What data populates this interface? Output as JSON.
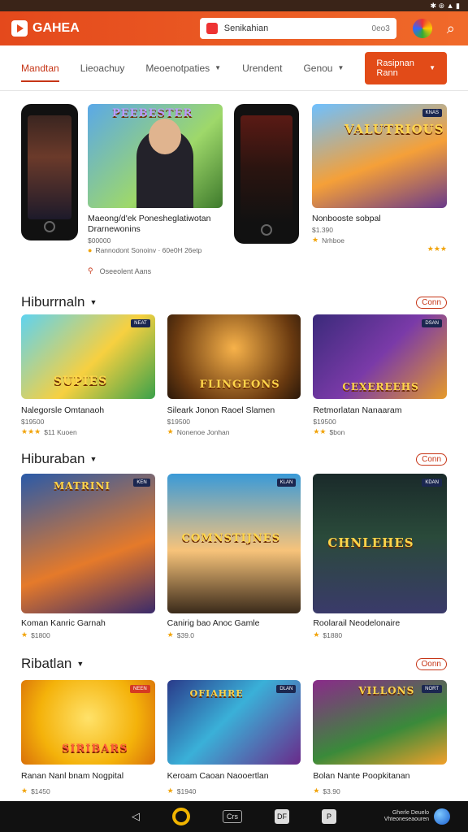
{
  "status": {
    "icons": "✱ ⊛ ▲ ▮"
  },
  "header": {
    "logo_text": "GAHEA",
    "search_value": "Senikahian",
    "search_code": "0eo3"
  },
  "tabs": [
    {
      "label": "Mandtan",
      "active": true
    },
    {
      "label": "Lieoachuy"
    },
    {
      "label": "Meoenotpaties",
      "dropdown": true
    },
    {
      "label": "Urendent"
    },
    {
      "label": "Genou",
      "dropdown": true
    }
  ],
  "cta_label": "Rasipnan Rann",
  "featured": [
    {
      "title": "",
      "sub": ""
    },
    {
      "overlay": "PEEBESTER",
      "title": "Maeong/d'ek Ponesheglatiwotan Drarnewonins",
      "sub": "$00000",
      "meta": "Rannodont Sonoinv · 60e0H 26etp"
    },
    {
      "title": "",
      "sub": ""
    },
    {
      "overlay": "VALUTRIOUS",
      "badge": "KNAS",
      "title": "Nonbooste sobpal",
      "sub": "$1.390",
      "meta": "Nrhboe",
      "rating_label": "★★★"
    }
  ],
  "featured_footer": "Oseeolent Aans",
  "sections": [
    {
      "title": "Hiburrnaln",
      "more": "Conn",
      "items": [
        {
          "overlay": "SUPIES",
          "badge": "NEAT",
          "title": "Nalegorsle Omtanaoh",
          "sub": "$19500",
          "stars": "★★★",
          "meta": "$11 Kuoen"
        },
        {
          "overlay": "FLINGEONS",
          "title": "Sileark Jonon Raoel Slamen",
          "sub": "$19500",
          "stars": "★",
          "meta": "Nonenoe Jonhan"
        },
        {
          "overlay": "CEXEREEHS",
          "badge": "DSAN",
          "title": "Retmorlatan Nanaaram",
          "sub": "$19500",
          "stars": "★★",
          "meta": "$bon"
        }
      ]
    },
    {
      "title": "Hiburaban",
      "more": "Conn",
      "items": [
        {
          "overlay": "MATRINI",
          "badge": "KEN",
          "title": "Koman Kanric Garnah",
          "sub": "$1800",
          "stars": "★",
          "meta": ""
        },
        {
          "overlay": "COMNSTIJNES",
          "badge": "KLAN",
          "title": "Canirig bao Anoc Gamle",
          "sub": "$39.0",
          "stars": "★",
          "meta": ""
        },
        {
          "overlay": "CHNLEHES",
          "badge": "KDAN",
          "title": "Roolarail Neodelonaire",
          "sub": "$1880",
          "stars": "★",
          "meta": ""
        }
      ]
    },
    {
      "title": "Ribatlan",
      "more": "Oonn",
      "items": [
        {
          "overlay": "SIRIBARS",
          "badge": "NEEN",
          "title": "Ranan Nanl bnam Nogpital",
          "sub": "$1450",
          "stars": "★",
          "meta": ""
        },
        {
          "overlay": "OFIAHRE",
          "badge": "DLAN",
          "title": "Keroam Caoan Naooertlan",
          "sub": "$1940",
          "stars": "★",
          "meta": ""
        },
        {
          "overlay": "VILLONS",
          "badge": "NORT",
          "title": "Bolan Nante Poopkitanan",
          "sub": "$3.90",
          "stars": "★",
          "meta": ""
        }
      ]
    }
  ],
  "navbar": {
    "back": "◁",
    "pill": "Crs",
    "tile1": "DF",
    "tile2": "P",
    "brand_line1": "Gherle Deuelo",
    "brand_line2": "Vhteoneseaouren"
  },
  "colors": {
    "accent": "#e4491c",
    "link": "#c63516",
    "star": "#f1a40c"
  }
}
